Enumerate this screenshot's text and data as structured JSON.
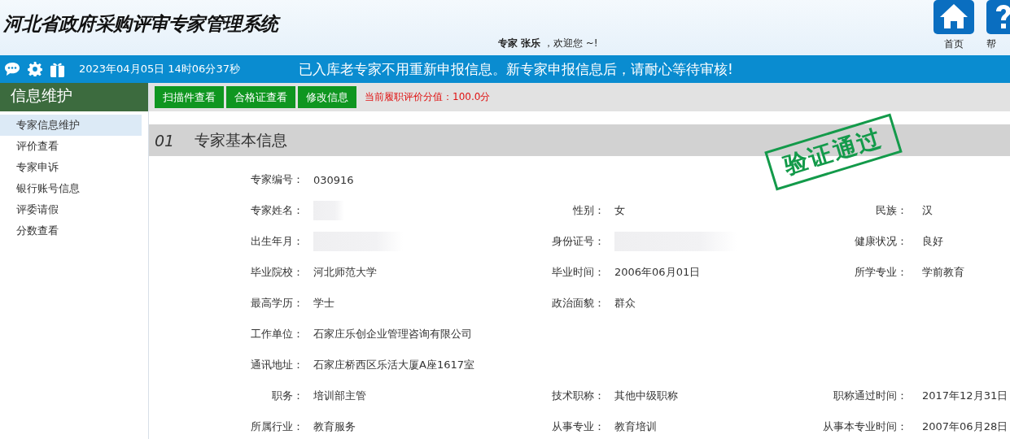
{
  "header": {
    "title": "河北省政府采购评审专家管理系统",
    "welcome": {
      "role": "专家",
      "name": "张乐",
      "greeting": "，欢迎您 ~!"
    },
    "nav": [
      {
        "kind": "home",
        "label": "首页"
      },
      {
        "kind": "help",
        "label": "帮"
      }
    ]
  },
  "infobar": {
    "datetime": "2023年04月05日 14时06分37秒",
    "notice": "已入库老专家不用重新申报信息。新专家申报信息后，请耐心等待审核!"
  },
  "sidebar": {
    "title": "信息维护",
    "items": [
      {
        "label": "专家信息维护",
        "selected": true
      },
      {
        "label": "评价查看",
        "selected": false
      },
      {
        "label": "专家申诉",
        "selected": false
      },
      {
        "label": "银行账号信息",
        "selected": false
      },
      {
        "label": "评委请假",
        "selected": false
      },
      {
        "label": "分数查看",
        "selected": false
      }
    ]
  },
  "toolbar": {
    "buttons": [
      "扫描件查看",
      "合格证查看",
      "修改信息"
    ],
    "score": "当前履职评价分值：100.0分"
  },
  "section": {
    "number": "01",
    "title": "专家基本信息",
    "stamp": "验证通过",
    "rows": [
      [
        {
          "label": "专家编号：",
          "value": "030916"
        }
      ],
      [
        {
          "label": "专家姓名：",
          "redacted": true
        },
        {
          "label": "性别：",
          "value": "女"
        },
        {
          "label": "民族：",
          "value": "汉"
        }
      ],
      [
        {
          "label": "出生年月：",
          "redacted": true
        },
        {
          "label": "身份证号：",
          "redacted": true
        },
        {
          "label": "健康状况：",
          "value": "良好"
        }
      ],
      [
        {
          "label": "毕业院校：",
          "value": "河北师范大学"
        },
        {
          "label": "毕业时间：",
          "value": "2006年06月01日"
        },
        {
          "label": "所学专业：",
          "value": "学前教育"
        }
      ],
      [
        {
          "label": "最高学历：",
          "value": "学士"
        },
        {
          "label": "政治面貌：",
          "value": "群众"
        }
      ],
      [
        {
          "label": "工作单位：",
          "value": "石家庄乐创企业管理咨询有限公司"
        }
      ],
      [
        {
          "label": "通讯地址：",
          "value": "石家庄桥西区乐活大厦A座1617室"
        }
      ],
      [
        {
          "label": "职务：",
          "value": "培训部主管"
        },
        {
          "label": "技术职称：",
          "value": "其他中级职称"
        },
        {
          "label": "职称通过时间：",
          "value": "2017年12月31日"
        }
      ],
      [
        {
          "label": "所属行业：",
          "value": "教育服务"
        },
        {
          "label": "从事专业：",
          "value": "教育培训"
        },
        {
          "label": "从事本专业时间：",
          "value": "2007年06月28日"
        }
      ]
    ]
  }
}
